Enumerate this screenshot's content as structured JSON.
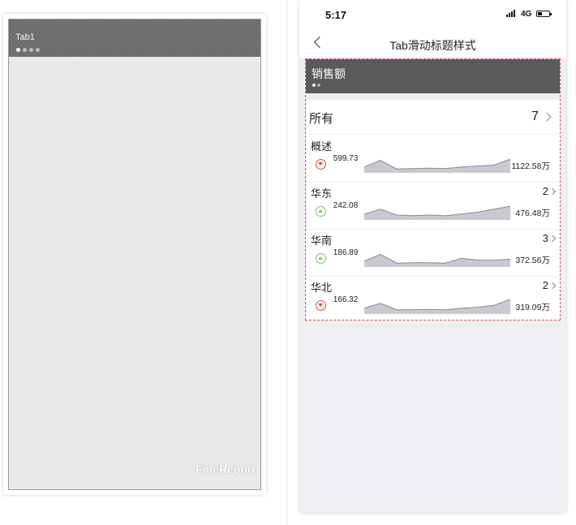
{
  "designer": {
    "tab_label": "Tab1",
    "dots": [
      true,
      false,
      false,
      false
    ],
    "watermark": "FineReport"
  },
  "phone": {
    "status": {
      "time": "5:17",
      "network": "4G"
    },
    "nav": {
      "title": "Tab滑动标题样式"
    },
    "tab": {
      "label": "销售额",
      "dots": [
        true,
        false
      ]
    },
    "summary": {
      "label": "所有",
      "count": "7"
    },
    "regions": [
      {
        "name": "概述",
        "count": "",
        "trend": "down",
        "small": "599.73",
        "big": "1122.58万",
        "spark": [
          0.3,
          0.65,
          0.2,
          0.22,
          0.24,
          0.22,
          0.3,
          0.35,
          0.4,
          0.7
        ]
      },
      {
        "name": "华东",
        "count": "2",
        "trend": "up",
        "small": "242.08",
        "big": "476.48万",
        "spark": [
          0.3,
          0.55,
          0.25,
          0.22,
          0.25,
          0.22,
          0.3,
          0.4,
          0.55,
          0.7
        ]
      },
      {
        "name": "华南",
        "count": "3",
        "trend": "up",
        "small": "186.89",
        "big": "372.56万",
        "spark": [
          0.3,
          0.65,
          0.2,
          0.22,
          0.22,
          0.2,
          0.45,
          0.35,
          0.35,
          0.4
        ]
      },
      {
        "name": "华北",
        "count": "2",
        "trend": "down",
        "small": "166.32",
        "big": "319.09万",
        "spark": [
          0.3,
          0.55,
          0.22,
          0.22,
          0.24,
          0.22,
          0.3,
          0.35,
          0.45,
          0.75
        ]
      }
    ],
    "colors": {
      "tab_bg": "#5a5a5a",
      "down": "#e8463d",
      "up": "#7ac36a",
      "highlight_border": "#d9534f"
    }
  }
}
